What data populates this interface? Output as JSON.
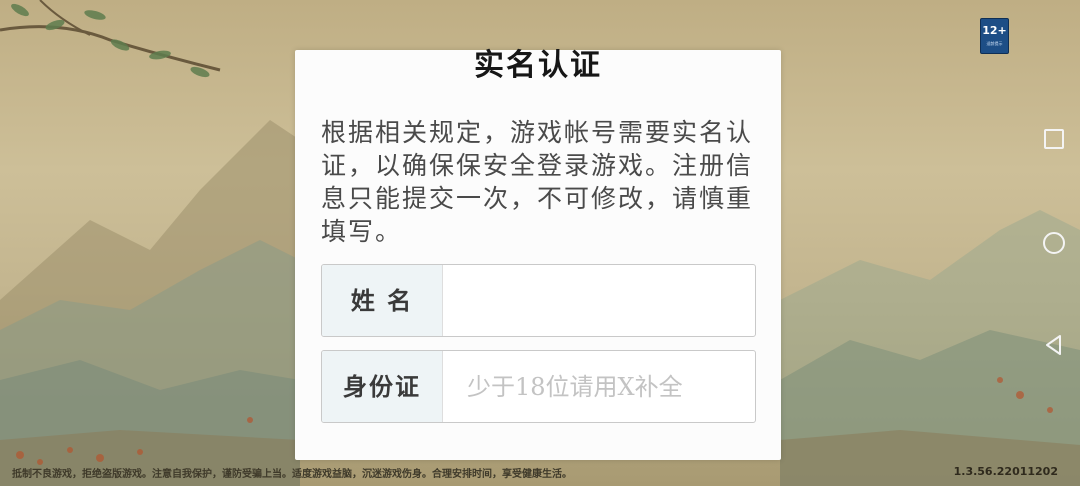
{
  "age_rating": {
    "label": "12+",
    "sub": "适龄提示"
  },
  "dialog": {
    "title": "实名认证",
    "description": "根据相关规定，游戏帐号需要实名认证，以确保保安全登录游戏。注册信息只能提交一次，不可修改，请慎重填写。",
    "fields": [
      {
        "label": "姓 名",
        "value": "",
        "placeholder": ""
      },
      {
        "label": "身份证",
        "value": "",
        "placeholder": "少于18位请用X补全"
      }
    ]
  },
  "footer": {
    "health_notice": "抵制不良游戏，拒绝盗版游戏。注意自我保护，谨防受骗上当。适度游戏益脑，沉迷游戏伤身。合理安排时间，享受健康生活。",
    "version": "1.3.56.22011202"
  },
  "nav_icons": [
    "recent-apps-icon",
    "home-icon",
    "back-icon"
  ],
  "colors": {
    "dialog_bg": "#fcfcfc",
    "label_bg": "#eef4f6",
    "title": "#161616",
    "text": "#4a4a4a"
  }
}
